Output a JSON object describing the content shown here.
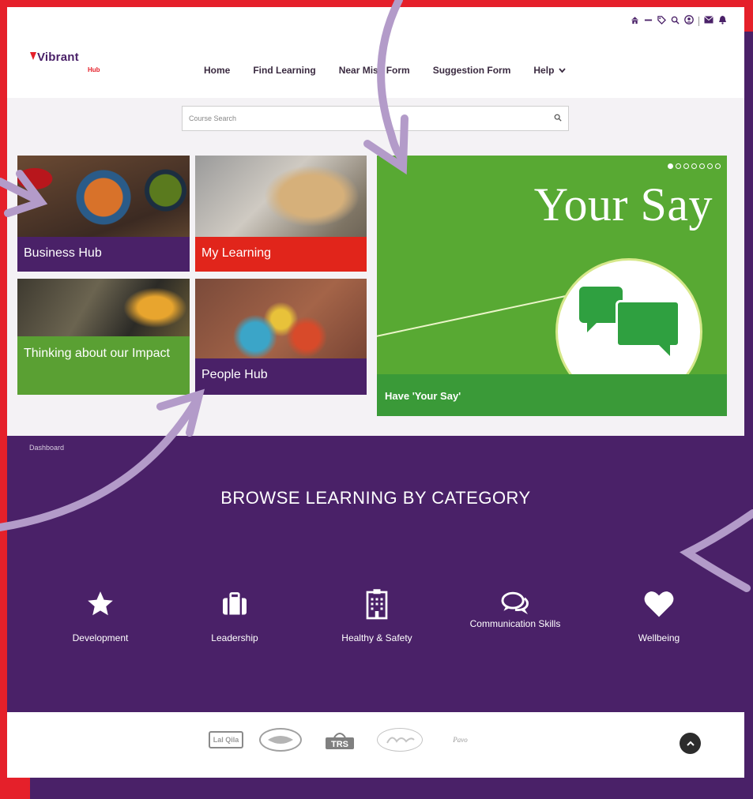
{
  "brand": {
    "name": "Vibrant",
    "sub": "Hub",
    "colors": {
      "purple": "#4a2168",
      "red": "#e5202a",
      "green": "#58a933"
    }
  },
  "top_icons": [
    "home-icon",
    "minus-icon",
    "tag-icon",
    "search-icon",
    "user-circle-icon",
    "envelope-icon",
    "bell-icon"
  ],
  "nav": {
    "items": [
      "Home",
      "Find Learning",
      "Near Miss Form",
      "Suggestion Form"
    ],
    "help": "Help"
  },
  "search": {
    "placeholder": "Course Search"
  },
  "tiles": [
    "Business Hub",
    "My Learning",
    "Thinking about our Impact",
    "People Hub"
  ],
  "carousel": {
    "heading": "Your Say",
    "caption": "Have 'Your Say'",
    "slides": 7,
    "active_slide": 1
  },
  "breadcrumb": "Dashboard",
  "browse": {
    "title": "BROWSE LEARNING BY CATEGORY",
    "categories": [
      {
        "name": "Development",
        "icon": "star-icon"
      },
      {
        "name": "Leadership",
        "icon": "briefcase-icon"
      },
      {
        "name": "Healthy & Safety",
        "icon": "building-icon"
      },
      {
        "name": "Communication Skills",
        "icon": "chat-bubbles-icon"
      },
      {
        "name": "Wellbeing",
        "icon": "heart-icon"
      }
    ]
  },
  "footer": {
    "partners": [
      "Lal Qila",
      "",
      "TRS",
      "",
      "Pavo"
    ],
    "to_top": "back-to-top-icon"
  }
}
